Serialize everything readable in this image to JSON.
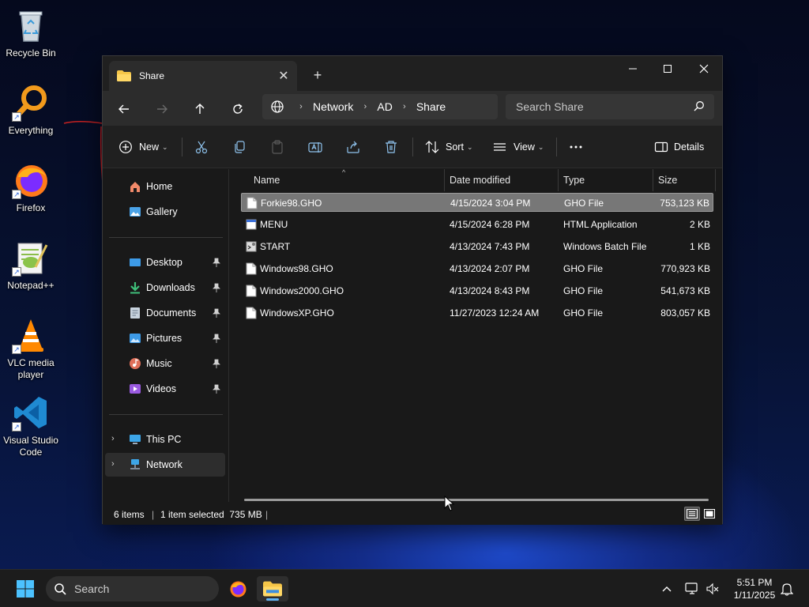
{
  "desktop": {
    "icons": [
      {
        "label": "Recycle Bin"
      },
      {
        "label": "Everything"
      },
      {
        "label": "Firefox"
      },
      {
        "label": "Notepad++"
      },
      {
        "label": "VLC media player"
      },
      {
        "label": "Visual Studio Code"
      }
    ]
  },
  "window": {
    "tab_title": "Share",
    "breadcrumb": [
      "Network",
      "AD",
      "Share"
    ],
    "search_placeholder": "Search Share",
    "commands": {
      "new": "New",
      "sort": "Sort",
      "view": "View",
      "details": "Details"
    },
    "nav": {
      "home": "Home",
      "gallery": "Gallery",
      "desktop": "Desktop",
      "downloads": "Downloads",
      "documents": "Documents",
      "pictures": "Pictures",
      "music": "Music",
      "videos": "Videos",
      "this_pc": "This PC",
      "network": "Network"
    },
    "columns": {
      "name": "Name",
      "date": "Date modified",
      "type": "Type",
      "size": "Size"
    },
    "files": [
      {
        "name": "Forkie98.GHO",
        "date": "4/15/2024 3:04 PM",
        "type": "GHO File",
        "size": "753,123 KB",
        "icon": "file-icon",
        "selected": true
      },
      {
        "name": "MENU",
        "date": "4/15/2024 6:28 PM",
        "type": "HTML Application",
        "size": "2 KB",
        "icon": "hta-icon"
      },
      {
        "name": "START",
        "date": "4/13/2024 7:43 PM",
        "type": "Windows Batch File",
        "size": "1 KB",
        "icon": "batch-icon"
      },
      {
        "name": "Windows98.GHO",
        "date": "4/13/2024 2:07 PM",
        "type": "GHO File",
        "size": "770,923 KB",
        "icon": "file-icon"
      },
      {
        "name": "Windows2000.GHO",
        "date": "4/13/2024 8:43 PM",
        "type": "GHO File",
        "size": "541,673 KB",
        "icon": "file-icon"
      },
      {
        "name": "WindowsXP.GHO",
        "date": "11/27/2023 12:24 AM",
        "type": "GHO File",
        "size": "803,057 KB",
        "icon": "file-icon"
      }
    ],
    "status": {
      "items": "6 items",
      "selected": "1 item selected  735 MB"
    }
  },
  "taskbar": {
    "search_label": "Search",
    "time": "5:51 PM",
    "date": "1/11/2025"
  },
  "colors": {
    "accent": "#5fb2f2",
    "window_bg": "#191919",
    "selected_row": "#777777"
  }
}
